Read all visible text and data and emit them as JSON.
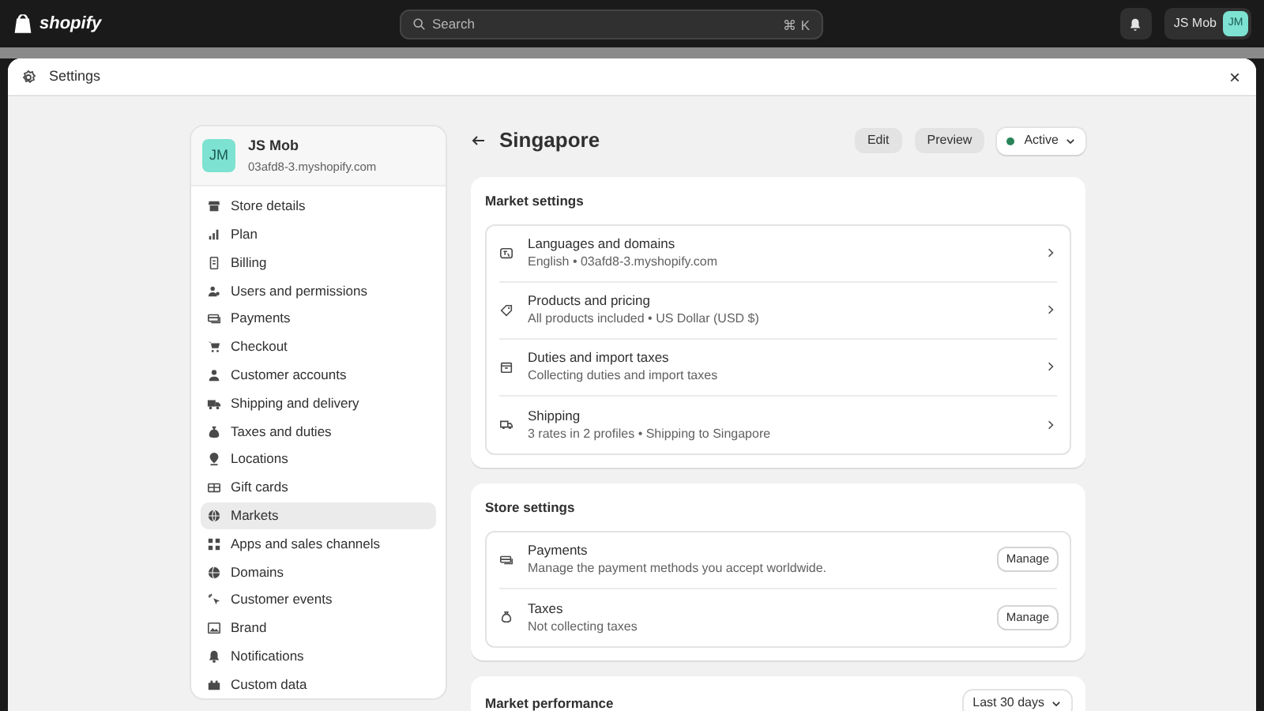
{
  "topbar": {
    "logo_text": "shopify",
    "search": {
      "placeholder": "Search",
      "shortcut": "⌘ K"
    },
    "user": {
      "name": "JS Mob",
      "initials": "JM"
    }
  },
  "modal": {
    "title": "Settings",
    "close": "×"
  },
  "sidebar": {
    "store": {
      "initials": "JM",
      "name": "JS Mob",
      "domain": "03afd8-3.myshopify.com"
    },
    "items": [
      {
        "label": "Store details",
        "selected": false
      },
      {
        "label": "Plan",
        "selected": false
      },
      {
        "label": "Billing",
        "selected": false
      },
      {
        "label": "Users and permissions",
        "selected": false
      },
      {
        "label": "Payments",
        "selected": false
      },
      {
        "label": "Checkout",
        "selected": false
      },
      {
        "label": "Customer accounts",
        "selected": false
      },
      {
        "label": "Shipping and delivery",
        "selected": false
      },
      {
        "label": "Taxes and duties",
        "selected": false
      },
      {
        "label": "Locations",
        "selected": false
      },
      {
        "label": "Gift cards",
        "selected": false
      },
      {
        "label": "Markets",
        "selected": true
      },
      {
        "label": "Apps and sales channels",
        "selected": false
      },
      {
        "label": "Domains",
        "selected": false
      },
      {
        "label": "Customer events",
        "selected": false
      },
      {
        "label": "Brand",
        "selected": false
      },
      {
        "label": "Notifications",
        "selected": false
      },
      {
        "label": "Custom data",
        "selected": false
      }
    ]
  },
  "page": {
    "title": "Singapore",
    "buttons": [
      "Edit",
      "Preview"
    ],
    "status": {
      "label": "Active",
      "color": "#29845a"
    }
  },
  "sections": [
    {
      "title": "Market settings",
      "rows": [
        {
          "kind": "link",
          "title": "Languages and domains",
          "subtitle": "English • 03afd8-3.myshopify.com"
        },
        {
          "kind": "link",
          "title": "Products and pricing",
          "subtitle": "All products included • US Dollar (USD $)"
        },
        {
          "kind": "link",
          "title": "Duties and import taxes",
          "subtitle": "Collecting duties and import taxes"
        },
        {
          "kind": "link",
          "title": "Shipping",
          "subtitle": "3 rates in 2 profiles • Shipping to Singapore"
        }
      ]
    },
    {
      "title": "Store settings",
      "rows": [
        {
          "kind": "manage",
          "title": "Payments",
          "subtitle": "Manage the payment methods you accept worldwide.",
          "button": "Manage"
        },
        {
          "kind": "manage",
          "title": "Taxes",
          "subtitle": "Not collecting taxes",
          "button": "Manage"
        }
      ]
    }
  ],
  "performance": {
    "title": "Market performance",
    "range": "Last 30 days"
  }
}
